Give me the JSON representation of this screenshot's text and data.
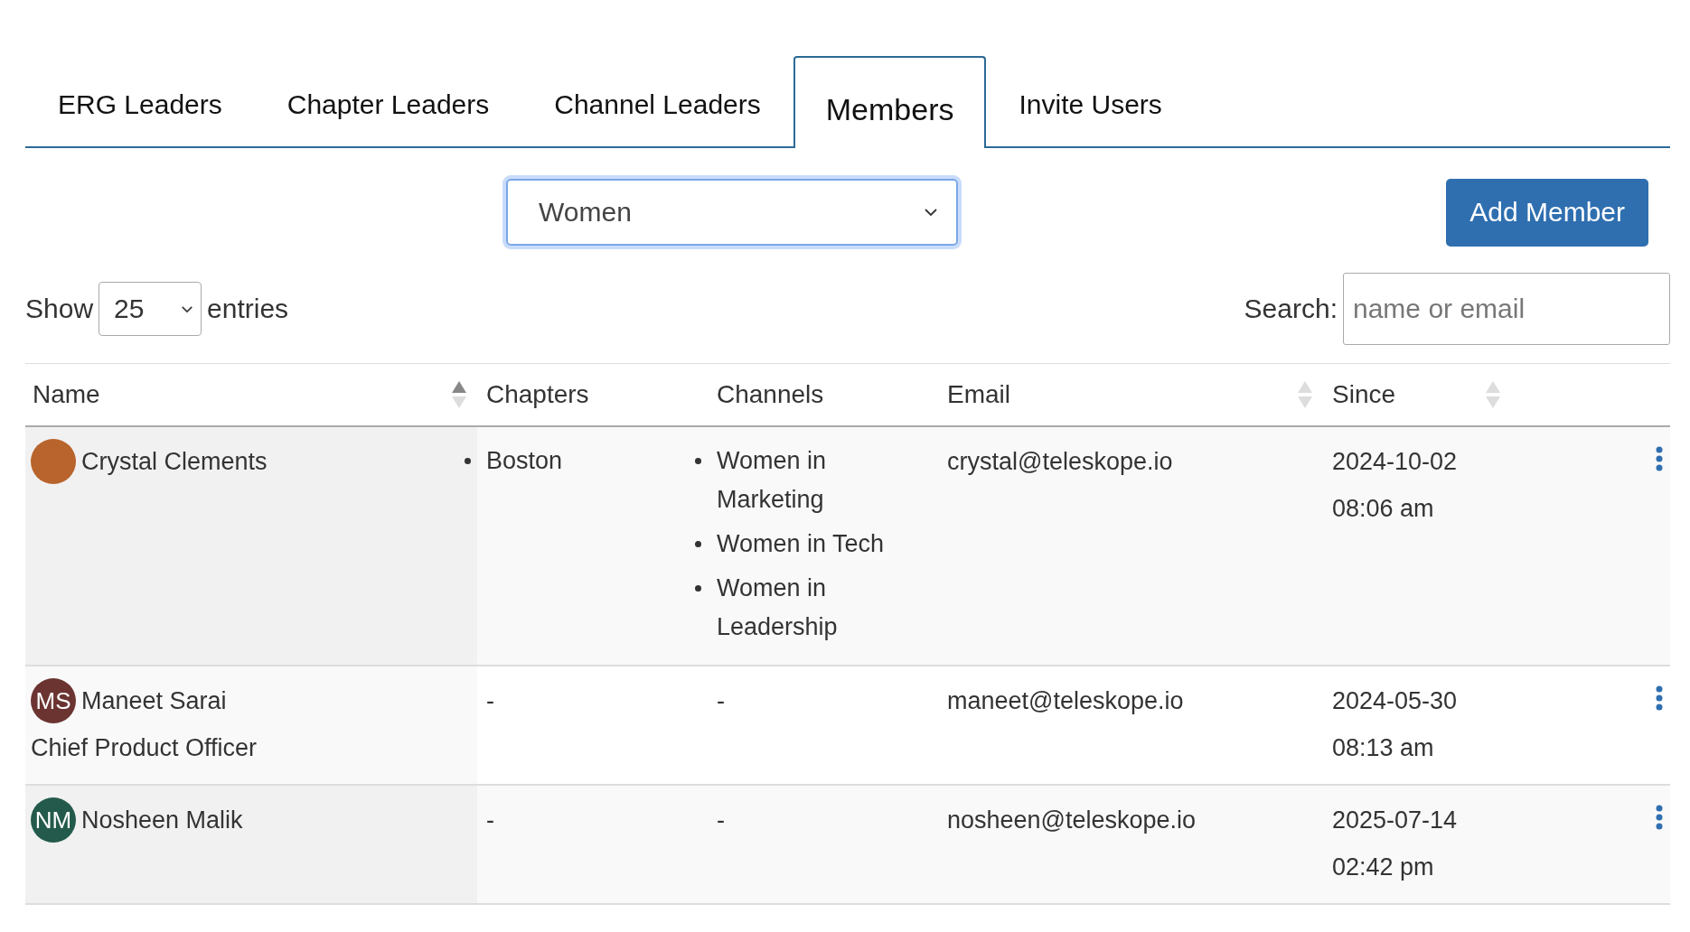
{
  "tabs": [
    {
      "label": "ERG Leaders",
      "selected": false
    },
    {
      "label": "Chapter Leaders",
      "selected": false
    },
    {
      "label": "Channel Leaders",
      "selected": false
    },
    {
      "label": "Members",
      "selected": true
    },
    {
      "label": "Invite Users",
      "selected": false
    }
  ],
  "group_select": {
    "value": "Women"
  },
  "add_button": "Add Member",
  "length_control": {
    "before": "Show",
    "value": "25",
    "after": "entries"
  },
  "search": {
    "label": "Search:",
    "placeholder": "name or email"
  },
  "table": {
    "columns": [
      {
        "label": "Name",
        "sortable": true,
        "sorted": true
      },
      {
        "label": "Chapters",
        "sortable": false
      },
      {
        "label": "Channels",
        "sortable": false
      },
      {
        "label": "Email",
        "sortable": true,
        "sorted": false
      },
      {
        "label": "Since",
        "sortable": true,
        "sorted": false
      }
    ],
    "rows": [
      {
        "avatar": {
          "kind": "photo"
        },
        "name": "Crystal Clements",
        "chapters": [
          "Boston"
        ],
        "channels": [
          "Women in Marketing",
          "Women in Tech",
          "Women in Leadership"
        ],
        "email": "crystal@teleskope.io",
        "date": "2024-10-02",
        "time": "08:06 am"
      },
      {
        "avatar": {
          "kind": "initials",
          "initials": "MS",
          "color": "#6b3431"
        },
        "name": "Maneet Sarai",
        "title": "Chief Product Officer",
        "chapters": "-",
        "channels": "-",
        "email": "maneet@teleskope.io",
        "date": "2024-05-30",
        "time": "08:13 am"
      },
      {
        "avatar": {
          "kind": "initials",
          "initials": "NM",
          "color": "#245a4b"
        },
        "name": "Nosheen Malik",
        "chapters": "-",
        "channels": "-",
        "email": "nosheen@teleskope.io",
        "date": "2025-07-14",
        "time": "02:42 pm"
      }
    ]
  }
}
